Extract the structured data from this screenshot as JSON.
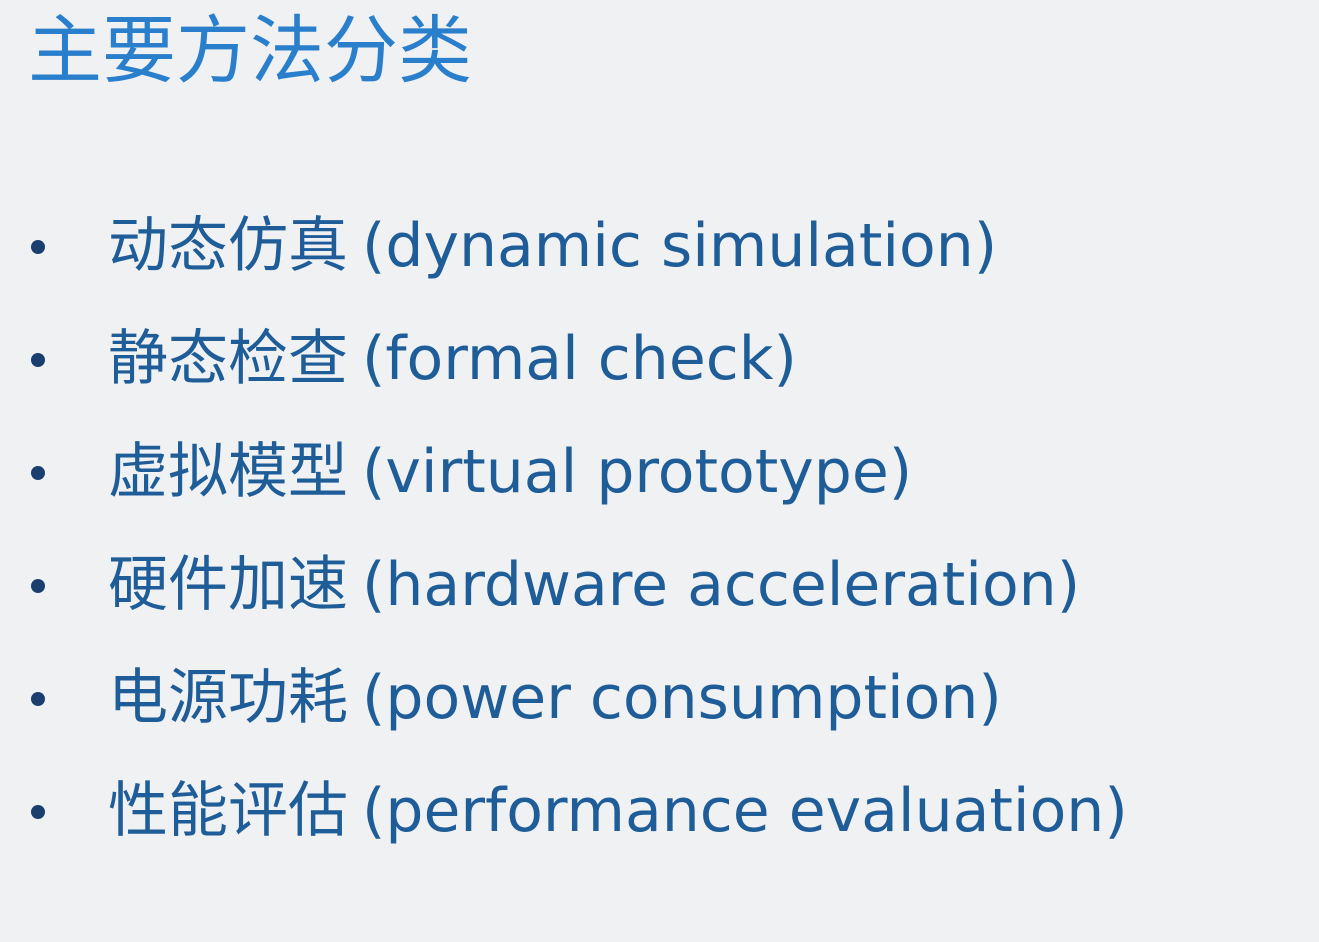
{
  "slide": {
    "title": "主要方法分类",
    "items": [
      {
        "zh": "动态仿真",
        "en": "(dynamic simulation)"
      },
      {
        "zh": "静态检查",
        "en": "(formal check)"
      },
      {
        "zh": "虚拟模型",
        "en": "(virtual prototype)"
      },
      {
        "zh": "硬件加速",
        "en": "(hardware acceleration)"
      },
      {
        "zh": "电源功耗",
        "en": "(power consumption)"
      },
      {
        "zh": "性能评估",
        "en": "(performance evaluation)"
      }
    ]
  },
  "colors": {
    "title": "#2a7fcc",
    "text": "#1f5d99",
    "bullet": "#1a3f6e",
    "background": "#f0f1f3"
  }
}
